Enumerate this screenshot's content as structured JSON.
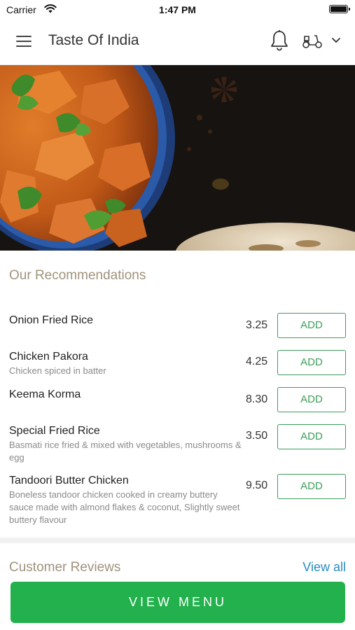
{
  "status_bar": {
    "carrier": "Carrier",
    "time": "1:47 PM"
  },
  "header": {
    "title": "Taste Of India",
    "menu_icon": "hamburger-menu-icon",
    "notification_icon": "bell-icon",
    "delivery_icon": "scooter-icon",
    "dropdown_icon": "chevron-down-icon"
  },
  "recommendations": {
    "title": "Our Recommendations",
    "add_label": "ADD",
    "items": [
      {
        "name": "Onion Fried Rice",
        "description": "",
        "price": "3.25"
      },
      {
        "name": "Chicken Pakora",
        "description": "Chicken spiced in batter",
        "price": "4.25"
      },
      {
        "name": "Keema Korma",
        "description": "",
        "price": "8.30"
      },
      {
        "name": "Special Fried Rice",
        "description": "Basmati rice fried & mixed with vegetables, mushrooms & egg",
        "price": "3.50"
      },
      {
        "name": "Tandoori Butter Chicken",
        "description": "Boneless tandoor chicken cooked in creamy buttery sauce made with almond flakes & coconut, Slightly sweet buttery flavour",
        "price": "9.50"
      }
    ]
  },
  "reviews": {
    "title": "Customer Reviews",
    "view_all": "View all"
  },
  "view_menu_label": "VIEW MENU",
  "colors": {
    "accent_green": "#22b14c",
    "add_green": "#3c9d5a",
    "link_blue": "#2a8cc0",
    "section_title": "#a0937c"
  }
}
